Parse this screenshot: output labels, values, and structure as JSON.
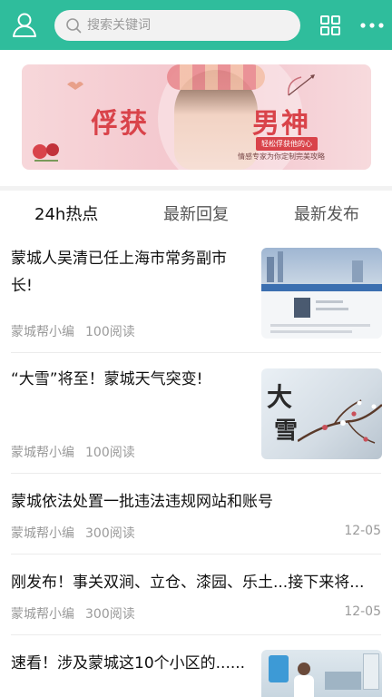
{
  "header": {
    "search_placeholder": "搜索关键词",
    "accent_color": "#2fbd9c"
  },
  "banner": {
    "title_left": "俘获",
    "title_right": "男神",
    "tagline": "轻松俘获他的心",
    "subline": "情感专家为你定制完美攻略"
  },
  "tabs": [
    {
      "label": "24h热点",
      "active": true
    },
    {
      "label": "最新回复",
      "active": false
    },
    {
      "label": "最新发布",
      "active": false
    }
  ],
  "news": [
    {
      "title_line1": "蒙城人吴清已任上海市常务副市",
      "title_line2": "长!",
      "author": "蒙城帮小编",
      "reads": "100阅读",
      "date": "",
      "thumb": "government-page-thumbnail"
    },
    {
      "title_line1": "“大雪”将至！蒙城天气突变!",
      "title_line2": "",
      "author": "蒙城帮小编",
      "reads": "100阅读",
      "date": "",
      "thumb": "snow-branch-thumbnail"
    },
    {
      "title_line1": "蒙城依法处置一批违法违规网站和账号",
      "title_line2": "",
      "author": "蒙城帮小编",
      "reads": "300阅读",
      "date": "12-05",
      "thumb": ""
    },
    {
      "title_line1": "刚发布！事关双涧、立仓、漆园、乐土...接下来将...",
      "title_line2": "",
      "author": "蒙城帮小编",
      "reads": "300阅读",
      "date": "12-05",
      "thumb": ""
    },
    {
      "title_line1": "速看！涉及蒙城这10个小区的......",
      "title_line2": "",
      "author": "",
      "reads": "",
      "date": "",
      "thumb": "clinic-photo-thumbnail"
    }
  ]
}
